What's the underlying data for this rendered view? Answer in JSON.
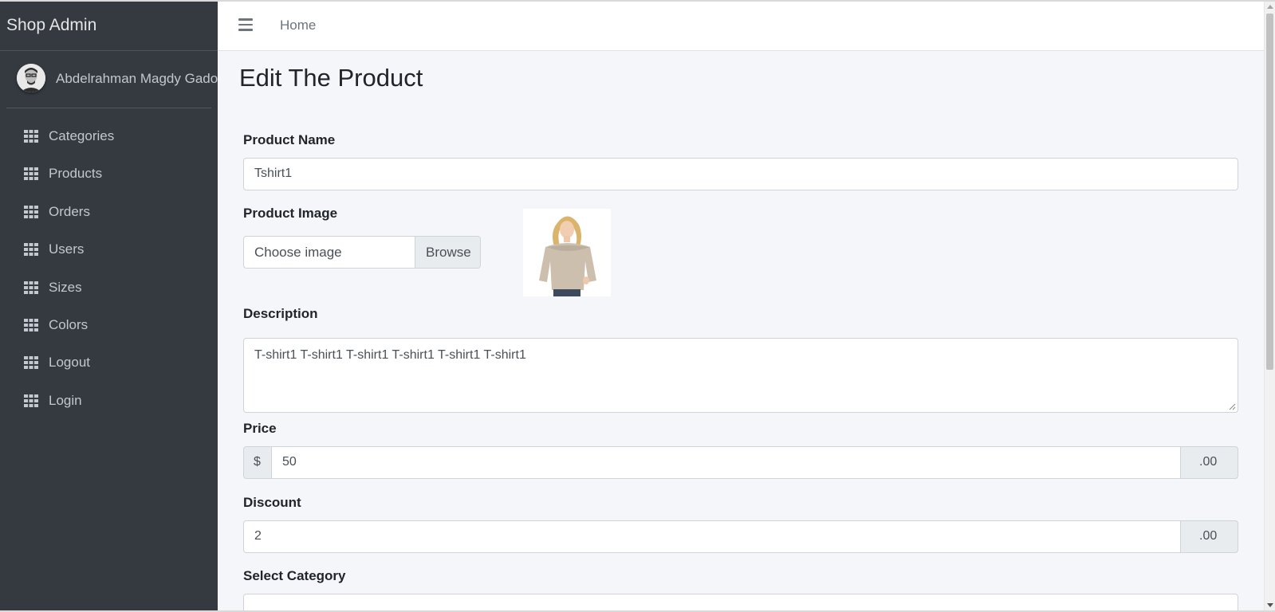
{
  "colors": {
    "sidebar_bg": "#343a40",
    "content_bg": "#f4f6f9",
    "sidebar_text": "#c2c7d0",
    "brand_text": "#e3e5e7"
  },
  "sidebar": {
    "brand": "Shop Admin",
    "user": {
      "name": "Abdelrahman Magdy Gado",
      "avatar_icon": "user-avatar"
    },
    "items": [
      {
        "label": "Categories",
        "icon": "grid-icon"
      },
      {
        "label": "Products",
        "icon": "grid-icon"
      },
      {
        "label": "Orders",
        "icon": "grid-icon"
      },
      {
        "label": "Users",
        "icon": "grid-icon"
      },
      {
        "label": "Sizes",
        "icon": "grid-icon"
      },
      {
        "label": "Colors",
        "icon": "grid-icon"
      },
      {
        "label": "Logout",
        "icon": "grid-icon"
      },
      {
        "label": "Login",
        "icon": "grid-icon"
      }
    ]
  },
  "navbar": {
    "menu_icon": "hamburger-icon",
    "home_label": "Home"
  },
  "form": {
    "title": "Edit The Product",
    "product_name": {
      "label": "Product Name",
      "value": "Tshirt1"
    },
    "product_image": {
      "label": "Product Image",
      "file_placeholder": "Choose image",
      "browse_label": "Browse"
    },
    "description": {
      "label": "Description",
      "value": "T-shirt1 T-shirt1 T-shirt1 T-shirt1 T-shirt1 T-shirt1"
    },
    "price": {
      "label": "Price",
      "prefix": "$",
      "value": "50",
      "suffix": ".00"
    },
    "discount": {
      "label": "Discount",
      "value": "2",
      "suffix": ".00"
    },
    "category": {
      "label": "Select Category"
    }
  }
}
